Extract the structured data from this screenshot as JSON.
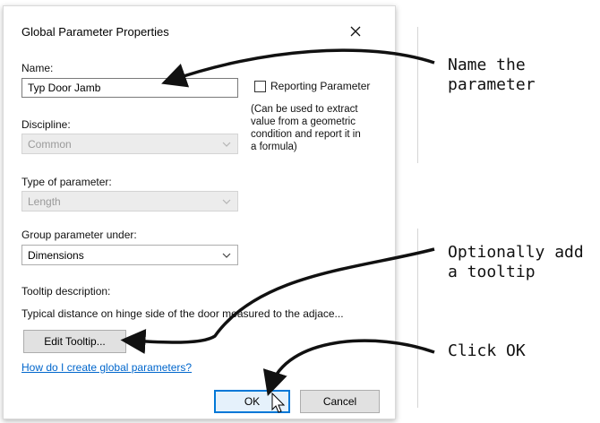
{
  "dialog": {
    "title": "Global Parameter Properties",
    "name_label": "Name:",
    "name_value": "Typ Door Jamb",
    "reporting_label": "Reporting Parameter",
    "reporting_checked": false,
    "reporting_hint": [
      "(Can be used to extract",
      "value from a geometric",
      "condition and report it in",
      "a formula)"
    ],
    "discipline_label": "Discipline:",
    "discipline_value": "Common",
    "type_label": "Type of parameter:",
    "type_value": "Length",
    "group_label": "Group parameter under:",
    "group_value": "Dimensions",
    "tooltip_label": "Tooltip description:",
    "tooltip_text": "Typical distance on hinge side of the door measured to the adjace...",
    "edit_tooltip_label": "Edit Tooltip...",
    "help_link": "How do I create global parameters?",
    "ok_label": "OK",
    "cancel_label": "Cancel"
  },
  "annotations": {
    "name": [
      "Name the",
      "parameter"
    ],
    "tooltip": [
      "Optionally add",
      "a tooltip"
    ],
    "ok": "Click OK"
  },
  "colors": {
    "accent": "#0078d7",
    "link": "#0066cc",
    "disabled_text": "#9a9a9a"
  },
  "icons": [
    "close-icon",
    "chevron-down-icon",
    "mouse-cursor-icon",
    "arrow-pointer"
  ]
}
